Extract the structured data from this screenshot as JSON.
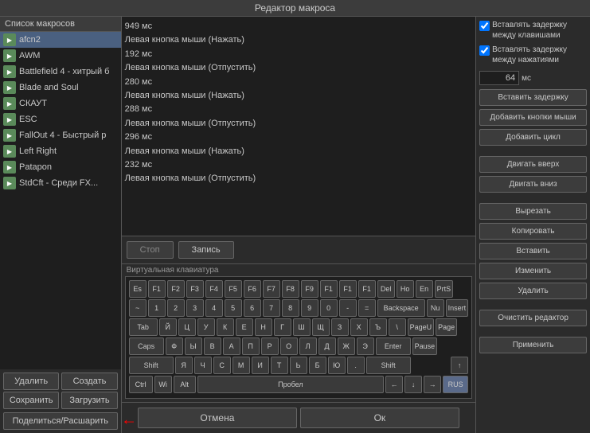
{
  "header": {
    "title": "Редактор макроса"
  },
  "left_panel": {
    "title": "Список макросов",
    "items": [
      {
        "id": "afcn2",
        "label": "afcn2",
        "selected": true
      },
      {
        "id": "AWM",
        "label": "AWM",
        "selected": false
      },
      {
        "id": "Battlefield4",
        "label": "Battlefield 4 - хитрый б",
        "selected": false
      },
      {
        "id": "BladeAndSoul",
        "label": "Blade and Soul",
        "selected": false
      },
      {
        "id": "SKAUT",
        "label": "СКАУТ",
        "selected": false
      },
      {
        "id": "ESC",
        "label": "ESC",
        "selected": false
      },
      {
        "id": "FallOut4",
        "label": "FallOut 4 - Быстрый р",
        "selected": false
      },
      {
        "id": "LeftRight",
        "label": "Left Right",
        "selected": false
      },
      {
        "id": "Patapon",
        "label": "Patapon",
        "selected": false
      },
      {
        "id": "StdCft",
        "label": "StdCft - Среди FX...",
        "selected": false
      }
    ],
    "delete_btn": "Удалить",
    "create_btn": "Создать",
    "save_btn": "Сохранить",
    "load_btn": "Загрузить",
    "share_btn": "Поделиться/Расшарить"
  },
  "editor": {
    "lines": [
      "949 мс",
      "Левая кнопка мыши (Нажать)",
      "192 мс",
      "Левая кнопка мыши (Отпустить)",
      "280 мс",
      "Левая кнопка мыши (Нажать)",
      "288 мс",
      "Левая кнопка мыши (Отпустить)",
      "296 мс",
      "Левая кнопка мыши (Нажать)",
      "232 мс",
      "Левая кнопка мыши (Отпустить)"
    ],
    "stop_btn": "Стоп",
    "record_btn": "Запись"
  },
  "keyboard": {
    "label": "Виртуальная клавиатура",
    "rows": [
      [
        "Es",
        "F1",
        "F2",
        "F3",
        "F4",
        "F5",
        "F6",
        "F7",
        "F8",
        "F9",
        "F1",
        "F1",
        "F1",
        "Del",
        "Ho",
        "En",
        "PrtS"
      ],
      [
        "~",
        "1",
        "2",
        "3",
        "4",
        "5",
        "6",
        "7",
        "8",
        "9",
        "0",
        "-",
        "=",
        "Backspace",
        "Nu",
        "Insert"
      ],
      [
        "Tab",
        "Й",
        "Ц",
        "У",
        "К",
        "Е",
        "Н",
        "Г",
        "Ш",
        "Щ",
        "З",
        "Х",
        "Ъ",
        "\\",
        "PageU",
        "Page"
      ],
      [
        "Caps",
        "Ф",
        "Ы",
        "В",
        "А",
        "П",
        "Р",
        "О",
        "Л",
        "Д",
        "Ж",
        "Э",
        "Enter",
        "",
        "Pause"
      ],
      [
        "Shift",
        "Я",
        "Ч",
        "С",
        "М",
        "И",
        "Т",
        "Ь",
        "Б",
        "Ю",
        ".",
        "Shift",
        "",
        "↑",
        ""
      ],
      [
        "Ctrl",
        "Wi",
        "Alt",
        "Пробел",
        "←",
        "↓",
        "→",
        "RUS"
      ]
    ]
  },
  "right_panel": {
    "option1_label": "Вставлять задержку между клавишами",
    "option1_checked": true,
    "option2_label": "Вставлять задержку между нажатиями",
    "option2_checked": true,
    "delay_value": "64",
    "delay_unit": "мс",
    "btn_insert_delay": "Вставить задержку",
    "btn_add_mouse": "Добавить кнопки мыши",
    "btn_add_cycle": "Добавить цикл",
    "btn_move_up": "Двигать вверх",
    "btn_move_down": "Двигать вниз",
    "btn_cut": "Вырезать",
    "btn_copy": "Копировать",
    "btn_paste": "Вставить",
    "btn_modify": "Изменить",
    "btn_delete": "Удалить",
    "btn_clear": "Очистить редактор",
    "btn_apply": "Применить"
  },
  "footer": {
    "cancel_btn": "Отмена",
    "ok_btn": "Ок"
  }
}
